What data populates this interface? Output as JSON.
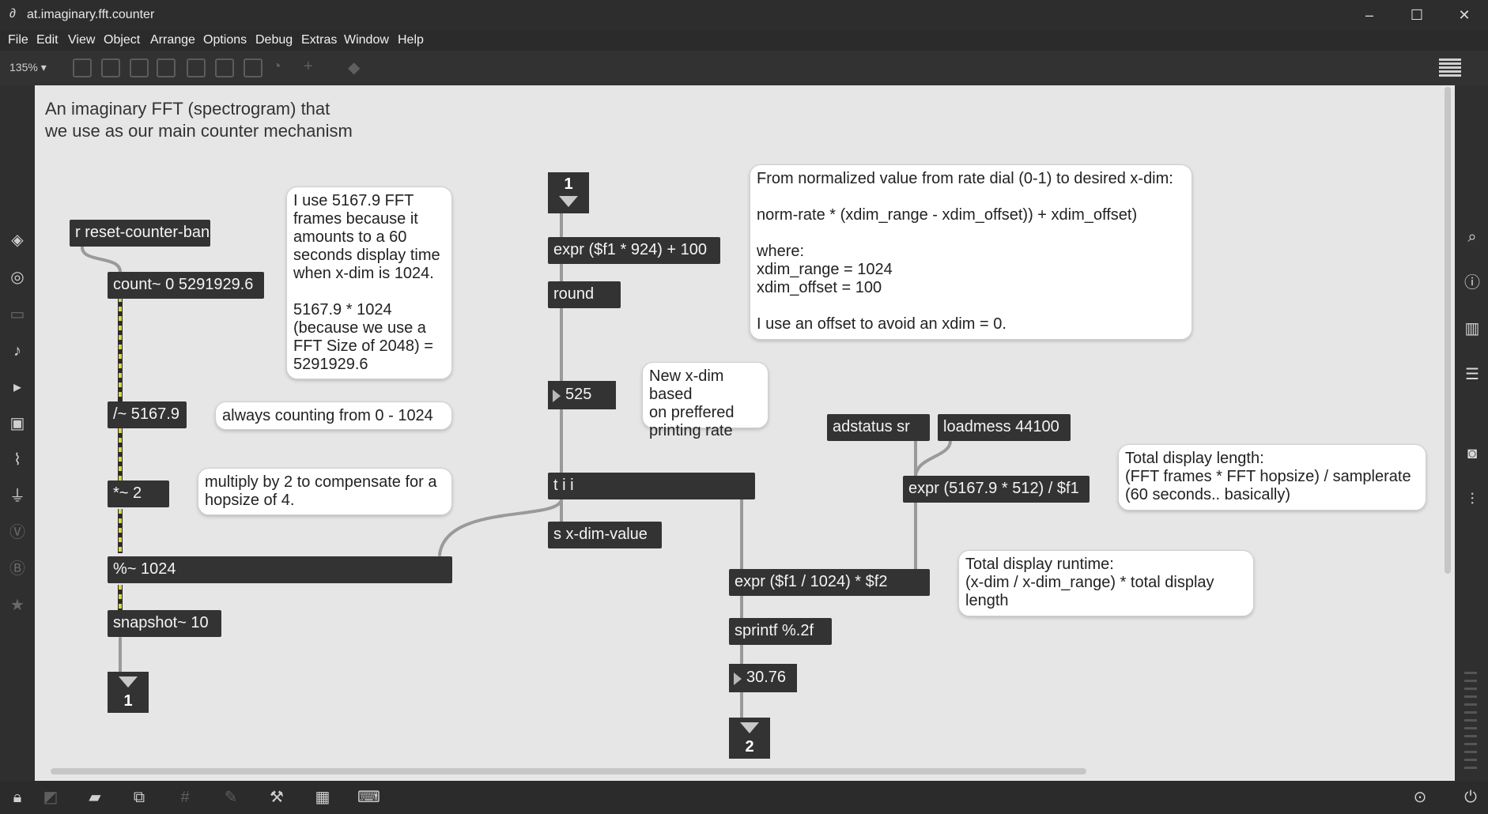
{
  "window": {
    "title": "at.imaginary.fft.counter",
    "minimize": "–",
    "maximize": "☐",
    "close": "✕"
  },
  "menus": [
    "File",
    "Edit",
    "View",
    "Object",
    "Arrange",
    "Options",
    "Debug",
    "Extras",
    "Window",
    "Help"
  ],
  "toolbar": {
    "zoom": "135% ▾"
  },
  "patch": {
    "title_line1": "An imaginary FFT (spectrogram) that",
    "title_line2": "we use as our main counter mechanism",
    "objects": {
      "receive": "r reset-counter-bang",
      "count": "count~ 0 5291929.6",
      "divide": "/~ 5167.9",
      "multiply": "*~ 2",
      "modulo": "%~ 1024",
      "snapshot": "snapshot~ 10",
      "expr_rate": "expr ($f1 * 924) + 100",
      "round": "round",
      "trigger": "t i i",
      "send": "s x-dim-value",
      "adstatus": "adstatus sr",
      "loadmess": "loadmess 44100",
      "expr_total": "expr (5167.9 * 512) / $f1",
      "expr_runtime": "expr ($f1 / 1024) * $f2",
      "sprintf": "sprintf %.2f"
    },
    "numboxes": {
      "xdim": "525",
      "runtime": "30.76"
    },
    "inlets_outlets": {
      "inlet1": "1",
      "outlet1": "1",
      "outlet2": "2"
    },
    "comments": {
      "fft_frames": "I use 5167.9 FFT\nframes because it\namounts to a 60\nseconds display time\nwhen x-dim is 1024.\n\n5167.9 * 1024\n(because we use a\nFFT Size of 2048) =\n5291929.6",
      "counting": "always counting from 0 - 1024",
      "multiply": "multiply by 2 to compensate for a\nhopsize of 4.",
      "formula": "From normalized value from rate dial (0-1) to desired x-dim:\n\nnorm-rate * (xdim_range - xdim_offset)) + xdim_offset)\n\nwhere:\nxdim_range = 1024\nxdim_offset = 100\n\nI use an offset to avoid an xdim = 0.",
      "new_xdim": "New x-dim based\non preffered\nprinting rate",
      "total_length": "Total display length:\n(FFT frames * FFT hopsize) / samplerate\n(60 seconds.. basically)",
      "total_runtime": "Total display runtime:\n(x-dim / x-dim_range) * total display\nlength"
    }
  }
}
